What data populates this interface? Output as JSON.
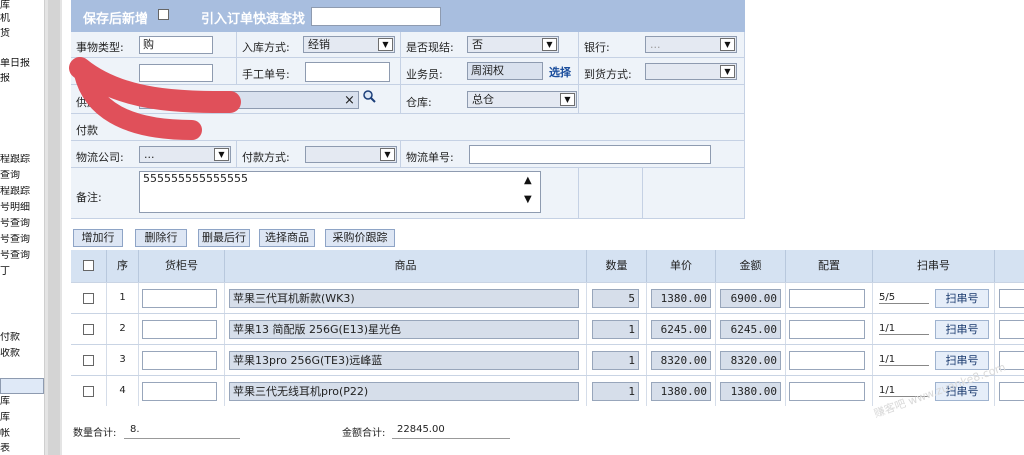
{
  "sidebar": {
    "items": [
      "库",
      "机",
      "货",
      "单日报",
      "报",
      "程跟踪",
      "查询",
      "程跟踪",
      "号明细",
      "号查询",
      "号查询",
      "号查询",
      "丁",
      "付款",
      "收款",
      "库",
      "库",
      "帐",
      "表"
    ]
  },
  "toolbar": {
    "save_new_label": "保存后新增",
    "save_new_checked": false,
    "quick_find_label": "引入订单快速查找",
    "quick_find_value": ""
  },
  "form": {
    "type_label": "事物类型:",
    "type_value": "购",
    "in_method_label": "入库方式:",
    "in_method_value": "经销",
    "is_cash_label": "是否现结:",
    "is_cash_value": "否",
    "bank_label": "银行:",
    "bank_value": "...",
    "manual_no_label": "手工单号:",
    "manual_no_value": "",
    "salesman_label": "业务员:",
    "salesman_value": "周润权",
    "salesman_select": "选择",
    "arrival_label": "到货方式:",
    "arrival_value": "",
    "supplier_label": "供应",
    "supplier_clear": "×",
    "warehouse_label": "仓库:",
    "warehouse_value": "总仓",
    "payment_account_label": "付款",
    "logistics_company_label": "物流公司:",
    "logistics_company_value": "...",
    "pay_method_label": "付款方式:",
    "pay_method_value": "",
    "logistics_no_label": "物流单号:",
    "logistics_no_value": "",
    "remark_label": "备注:",
    "remark_value": "555555555555555"
  },
  "actions": [
    "增加行",
    "删除行",
    "删最后行",
    "选择商品",
    "采购价跟踪"
  ],
  "grid": {
    "headers": [
      "序",
      "货柜号",
      "商品",
      "数量",
      "单价",
      "金额",
      "配置",
      "扫串号"
    ],
    "scan_button": "扫串号",
    "rows": [
      {
        "seq": "1",
        "container": "",
        "product": "苹果三代耳机新款(WK3)",
        "qty": "5",
        "price": "1380.00",
        "amount": "6900.00",
        "config": "",
        "scan": "5/5"
      },
      {
        "seq": "2",
        "container": "",
        "product": "苹果13 简配版 256G(E13)星光色",
        "qty": "1",
        "price": "6245.00",
        "amount": "6245.00",
        "config": "",
        "scan": "1/1"
      },
      {
        "seq": "3",
        "container": "",
        "product": "苹果13pro 256G(TE3)远峰蓝",
        "qty": "1",
        "price": "8320.00",
        "amount": "8320.00",
        "config": "",
        "scan": "1/1"
      },
      {
        "seq": "4",
        "container": "",
        "product": "苹果三代无线耳机pro(P22)",
        "qty": "1",
        "price": "1380.00",
        "amount": "1380.00",
        "config": "",
        "scan": "1/1"
      }
    ]
  },
  "footer": {
    "qty_total_label": "数量合计:",
    "qty_total_value": "8.",
    "amount_total_label": "金额合计:",
    "amount_total_value": "22845.00"
  },
  "watermark": "赚客吧 www.zuanke8.com",
  "colors": {
    "header_blue": "#a8bedf",
    "form_bg": "#eef3f9",
    "grid_header": "#d5e2f2",
    "red_mark": "#e0505a"
  }
}
